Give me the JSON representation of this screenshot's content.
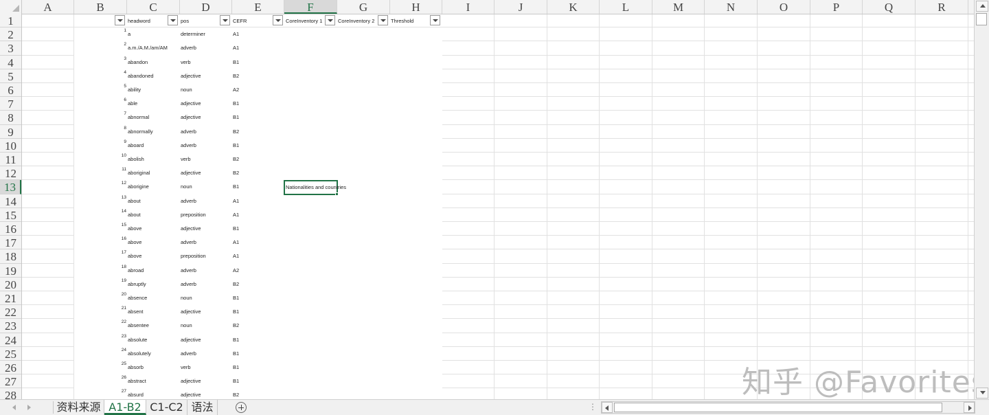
{
  "columns": [
    "A",
    "B",
    "C",
    "D",
    "E",
    "F",
    "G",
    "H",
    "I",
    "J",
    "K",
    "L",
    "M",
    "N",
    "O",
    "P",
    "Q",
    "R"
  ],
  "selected_column": "F",
  "row_numbers": [
    "1",
    "2",
    "3",
    "4",
    "5",
    "6",
    "7",
    "8",
    "9",
    "10",
    "11",
    "12",
    "13",
    "14",
    "15",
    "16",
    "17",
    "18",
    "19",
    "20",
    "21",
    "22",
    "23",
    "24",
    "25",
    "26",
    "27",
    "28"
  ],
  "selected_row": "13",
  "header_cells": {
    "c": "headword",
    "d": "pos",
    "e": "CEFR",
    "f": "CoreInventory 1",
    "g": "CoreInventory 2",
    "h": "Threshold"
  },
  "rows": [
    {
      "n": "1",
      "word": "a",
      "pos": "determiner",
      "cefr": "A1"
    },
    {
      "n": "2",
      "word": "a.m./A.M./am/AM",
      "pos": "adverb",
      "cefr": "A1"
    },
    {
      "n": "3",
      "word": "abandon",
      "pos": "verb",
      "cefr": "B1"
    },
    {
      "n": "4",
      "word": "abandoned",
      "pos": "adjective",
      "cefr": "B2"
    },
    {
      "n": "5",
      "word": "ability",
      "pos": "noun",
      "cefr": "A2"
    },
    {
      "n": "6",
      "word": "able",
      "pos": "adjective",
      "cefr": "B1"
    },
    {
      "n": "7",
      "word": "abnormal",
      "pos": "adjective",
      "cefr": "B1"
    },
    {
      "n": "8",
      "word": "abnormally",
      "pos": "adverb",
      "cefr": "B2"
    },
    {
      "n": "9",
      "word": "aboard",
      "pos": "adverb",
      "cefr": "B1"
    },
    {
      "n": "10",
      "word": "abolish",
      "pos": "verb",
      "cefr": "B2"
    },
    {
      "n": "11",
      "word": "aboriginal",
      "pos": "adjective",
      "cefr": "B2"
    },
    {
      "n": "12",
      "word": "aborigine",
      "pos": "noun",
      "cefr": "B1"
    },
    {
      "n": "13",
      "word": "about",
      "pos": "adverb",
      "cefr": "A1"
    },
    {
      "n": "14",
      "word": "about",
      "pos": "preposition",
      "cefr": "A1"
    },
    {
      "n": "15",
      "word": "above",
      "pos": "adjective",
      "cefr": "B1"
    },
    {
      "n": "16",
      "word": "above",
      "pos": "adverb",
      "cefr": "A1"
    },
    {
      "n": "17",
      "word": "above",
      "pos": "preposition",
      "cefr": "A1"
    },
    {
      "n": "18",
      "word": "abroad",
      "pos": "adverb",
      "cefr": "A2"
    },
    {
      "n": "19",
      "word": "abruptly",
      "pos": "adverb",
      "cefr": "B2"
    },
    {
      "n": "20",
      "word": "absence",
      "pos": "noun",
      "cefr": "B1"
    },
    {
      "n": "21",
      "word": "absent",
      "pos": "adjective",
      "cefr": "B1"
    },
    {
      "n": "22",
      "word": "absentee",
      "pos": "noun",
      "cefr": "B2"
    },
    {
      "n": "23",
      "word": "absolute",
      "pos": "adjective",
      "cefr": "B1"
    },
    {
      "n": "24",
      "word": "absolutely",
      "pos": "adverb",
      "cefr": "B1"
    },
    {
      "n": "25",
      "word": "absorb",
      "pos": "verb",
      "cefr": "B1"
    },
    {
      "n": "26",
      "word": "abstract",
      "pos": "adjective",
      "cefr": "B1"
    },
    {
      "n": "27",
      "word": "absurd",
      "pos": "adjective",
      "cefr": "B2"
    }
  ],
  "active_cell_text": "Nationalities and countries",
  "watermark": "知乎 @Favorites",
  "sheet_tabs": [
    "资料来源",
    "A1-B2",
    "C1-C2",
    "语法"
  ],
  "active_tab": "A1-B2"
}
